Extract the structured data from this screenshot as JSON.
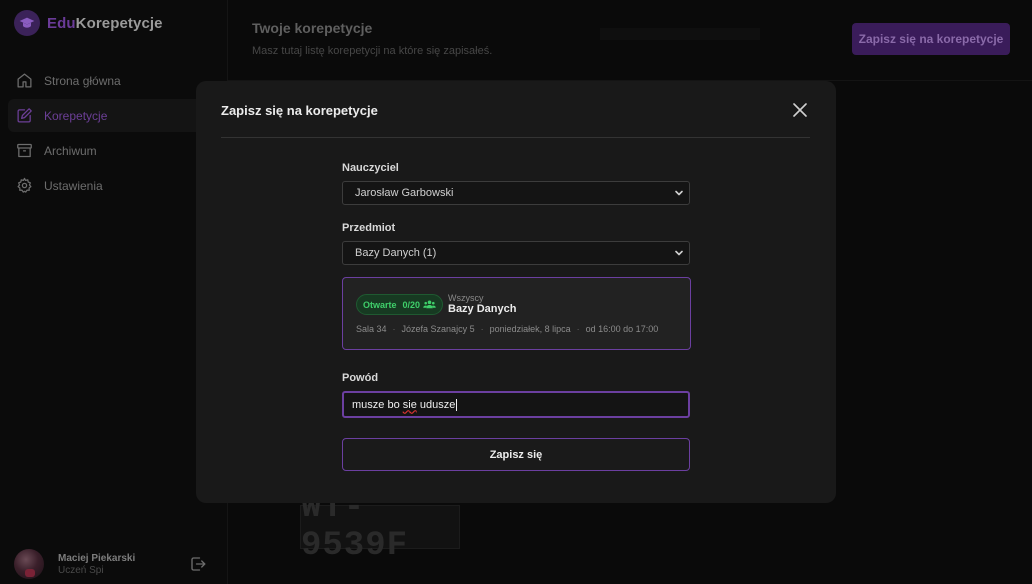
{
  "app": {
    "logo_prefix": "Edu",
    "logo_suffix": "Korepetycje"
  },
  "sidebar": {
    "items": [
      {
        "label": "Strona główna",
        "icon": "home-icon"
      },
      {
        "label": "Korepetycje",
        "icon": "edit-icon",
        "active": true
      },
      {
        "label": "Archiwum",
        "icon": "archive-icon"
      },
      {
        "label": "Ustawienia",
        "icon": "gear-icon"
      }
    ],
    "user": {
      "name": "Maciej Piekarski",
      "role": "Uczeń Spi"
    }
  },
  "main": {
    "title": "Twoje korepetycje",
    "subtitle": "Masz tutaj listę korepetycji na które się zapisałeś.",
    "enroll_button": "Zapisz się na korepetycje",
    "background_plate": "WT-9539F"
  },
  "modal": {
    "title": "Zapisz się na korepetycje",
    "teacher_label": "Nauczyciel",
    "teacher_value": "Jarosław Garbowski",
    "subject_label": "Przedmiot",
    "subject_value": "Bazy Danych (1)",
    "card": {
      "status": "Otwarte",
      "capacity": "0/20",
      "group": "Wszyscy",
      "subject": "Bazy Danych",
      "room": "Sala 34",
      "address": "Józefa Szanajcy 5",
      "date": "poniedziałek, 8 lipca",
      "time": "od 16:00 do 17:00"
    },
    "reason_label": "Powód",
    "reason_value_start": "musze bo ",
    "reason_value_misspelled": "sie",
    "reason_value_end": " udusze",
    "submit_label": "Zapisz się"
  },
  "colors": {
    "accent": "#6b3fa0",
    "badge_green": "#3fcf6a",
    "background": "#0a0a0a",
    "modal": "#191919"
  }
}
